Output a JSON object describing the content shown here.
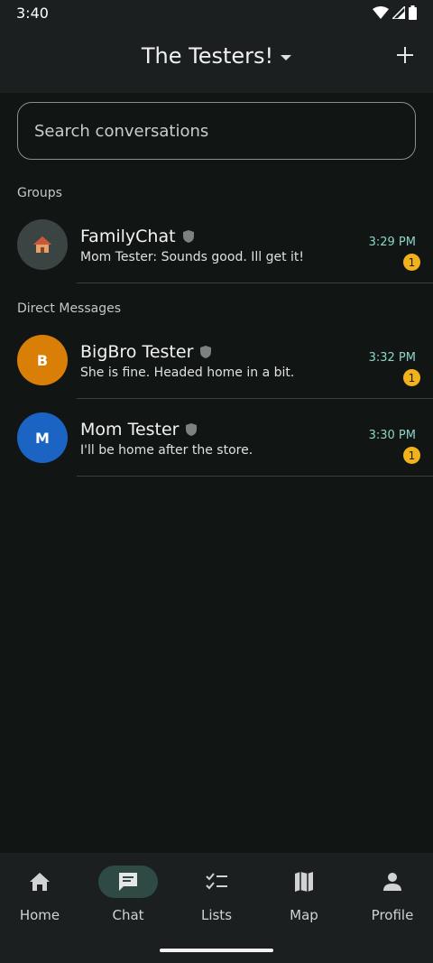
{
  "status": {
    "time": "3:40"
  },
  "header": {
    "title": "The Testers!"
  },
  "search": {
    "placeholder": "Search conversations"
  },
  "sections": {
    "groups": "Groups",
    "direct": "Direct Messages"
  },
  "groups": [
    {
      "name": "FamilyChat",
      "message": "Mom Tester: Sounds good.  Ill get it!",
      "time": "3:29 PM",
      "unread": "1",
      "avatar_icon": "house-icon"
    }
  ],
  "direct": [
    {
      "initial": "B",
      "name": "BigBro Tester",
      "message": "She is fine.  Headed home in a bit.",
      "time": "3:32 PM",
      "unread": "1",
      "color": "#d97f08"
    },
    {
      "initial": "M",
      "name": "Mom Tester",
      "message": "I'll be home after the store.",
      "time": "3:30 PM",
      "unread": "1",
      "color": "#1b64c4"
    }
  ],
  "nav": [
    {
      "label": "Home",
      "icon": "home-icon"
    },
    {
      "label": "Chat",
      "icon": "chat-icon",
      "active": true
    },
    {
      "label": "Lists",
      "icon": "checklist-icon"
    },
    {
      "label": "Map",
      "icon": "map-icon"
    },
    {
      "label": "Profile",
      "icon": "person-icon"
    }
  ],
  "colors": {
    "accent_time": "#8fd3c6",
    "badge": "#f2b21b",
    "background": "#111615"
  }
}
